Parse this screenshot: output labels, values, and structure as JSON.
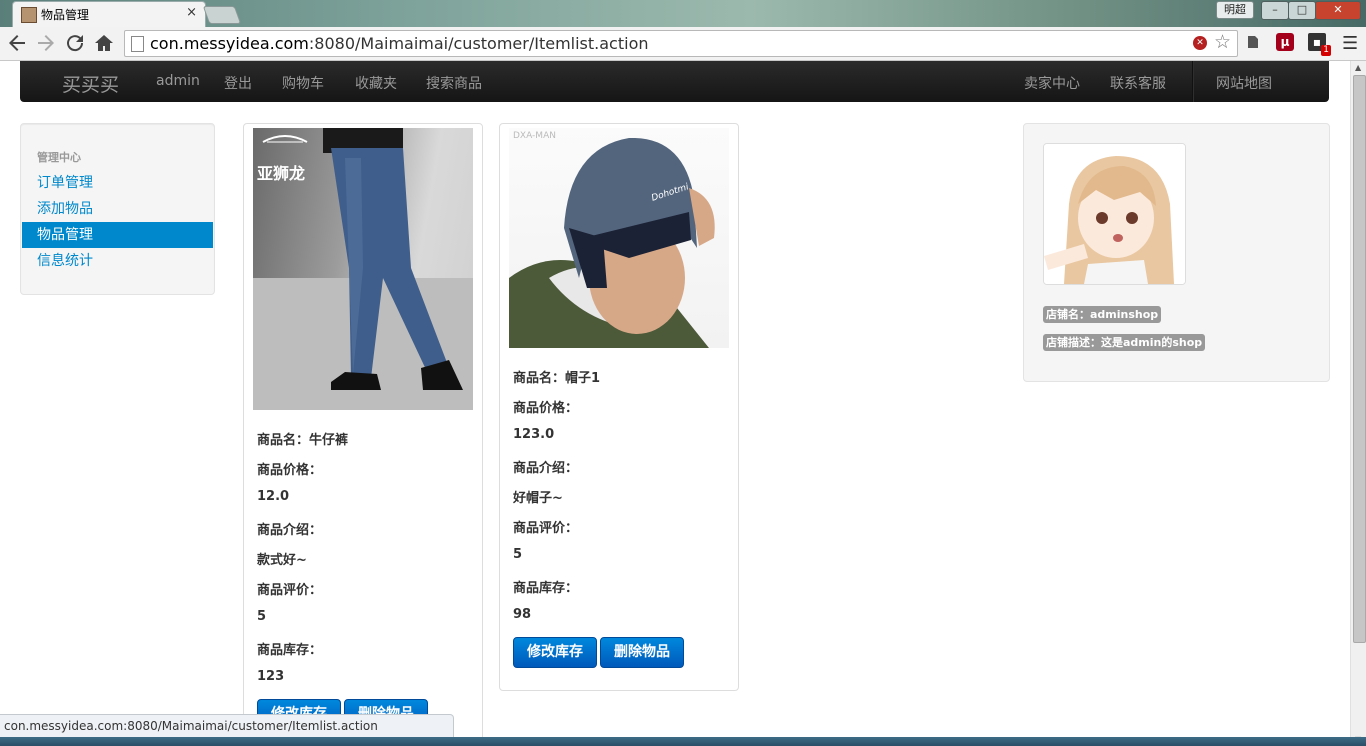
{
  "browser": {
    "tab_title": "物品管理",
    "tab_close": "×",
    "user_badge": "明超",
    "url_host": "con.messyidea.com",
    "url_rest": ":8080/Maimaimai/customer/Itemlist.action",
    "status_url": "con.messyidea.com:8080/Maimaimai/customer/Itemlist.action",
    "extension_badge_count": "1",
    "window_buttons": {
      "minimize": "–",
      "maximize": "□",
      "close": "✕"
    }
  },
  "navbar": {
    "brand": "买买买",
    "left_links": [
      "admin",
      "登出",
      "购物车",
      "收藏夹",
      "搜索商品"
    ],
    "right_links": [
      "卖家中心",
      "联系客服",
      "网站地图"
    ]
  },
  "sidebar": {
    "header": "管理中心",
    "items": [
      {
        "label": "订单管理",
        "active": false
      },
      {
        "label": "添加物品",
        "active": false
      },
      {
        "label": "物品管理",
        "active": true
      },
      {
        "label": "信息统计",
        "active": false
      }
    ]
  },
  "products": [
    {
      "image_brand": "亚狮龙",
      "name_label": "商品名：牛仔裤",
      "price_label": "商品价格：",
      "price": "12.0",
      "desc_label": "商品介绍：",
      "desc": "款式好~",
      "rating_label": "商品评价：",
      "rating": "5",
      "stock_label": "商品库存：",
      "stock": "123",
      "btn_edit": "修改库存",
      "btn_delete": "删除物品"
    },
    {
      "image_brand": "DXA-MAN",
      "hat_text": "Dohotmi",
      "name_label": "商品名：帽子1",
      "price_label": "商品价格：",
      "price": "123.0",
      "desc_label": "商品介绍：",
      "desc": "好帽子~",
      "rating_label": "商品评价：",
      "rating": "5",
      "stock_label": "商品库存：",
      "stock": "98",
      "btn_edit": "修改库存",
      "btn_delete": "删除物品"
    }
  ],
  "shop": {
    "name_label": "店铺名：adminshop",
    "desc_label": "店铺描述：这是admin的shop"
  },
  "colors": {
    "navbar_bg": "#1b1b1b",
    "link": "#0088cc",
    "active_bg": "#0088cc",
    "button_blue": "#0066cc",
    "label_grey": "#999999"
  }
}
